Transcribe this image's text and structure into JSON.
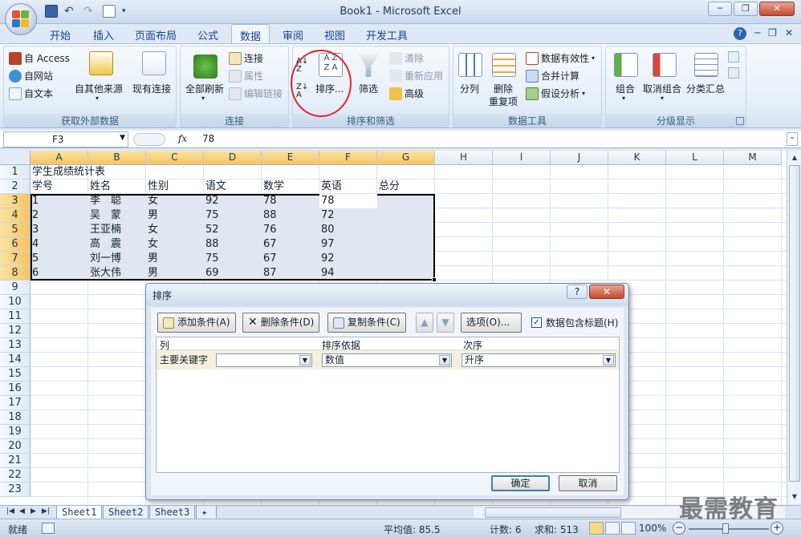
{
  "window": {
    "title": "Book1 - Microsoft Excel",
    "minimize_glyph": "─",
    "restore_glyph": "❐",
    "close_glyph": "✕"
  },
  "quick_access": [
    "save-icon",
    "undo-icon",
    "redo-icon",
    "print-preview-icon"
  ],
  "ribbon_tabs": [
    "开始",
    "插入",
    "页面布局",
    "公式",
    "数据",
    "审阅",
    "视图",
    "开发工具"
  ],
  "active_tab": "数据",
  "ribbon_right": {
    "help": "?",
    "min": "─",
    "restore": "❐",
    "close": "✕"
  },
  "ribbon": {
    "external": {
      "label": "获取外部数据",
      "access": "自 Access",
      "web": "自网站",
      "text": "自文本",
      "other": "自其他来源",
      "existing": "现有连接"
    },
    "connections": {
      "label": "连接",
      "refresh_all": "全部刷新",
      "connections": "连接",
      "properties": "属性",
      "edit_links": "编辑链接"
    },
    "sort_filter": {
      "label": "排序和筛选",
      "sort": "排序...",
      "filter": "筛选",
      "clear": "清除",
      "reapply": "重新应用",
      "advanced": "高级"
    },
    "data_tools": {
      "label": "数据工具",
      "text_to_columns": "分列",
      "remove_dup_1": "删除",
      "remove_dup_2": "重复项",
      "validation": "数据有效性",
      "consolidate": "合并计算",
      "what_if": "假设分析"
    },
    "outline": {
      "label": "分级显示",
      "group": "组合",
      "ungroup": "取消组合",
      "subtotal": "分类汇总"
    }
  },
  "formula_bar": {
    "name_box": "F3",
    "fx": "fx",
    "value": "78"
  },
  "columns": [
    "A",
    "B",
    "C",
    "D",
    "E",
    "F",
    "G",
    "H",
    "I",
    "J",
    "K",
    "L",
    "M"
  ],
  "rows": [
    "1",
    "2",
    "3",
    "4",
    "5",
    "6",
    "7",
    "8",
    "9",
    "10",
    "11",
    "12",
    "13",
    "14",
    "15",
    "16",
    "17",
    "18",
    "19",
    "20",
    "21",
    "22",
    "23"
  ],
  "cells": {
    "r1": {
      "a": "学生成绩统计表"
    },
    "header": [
      "学号",
      "姓名",
      "性别",
      "语文",
      "数学",
      "英语",
      "总分"
    ],
    "data": [
      [
        "1",
        "李　聪",
        "女",
        "92",
        "78",
        "78"
      ],
      [
        "2",
        "吴　蒙",
        "男",
        "75",
        "88",
        "72"
      ],
      [
        "3",
        "王亚楠",
        "女",
        "52",
        "76",
        "80"
      ],
      [
        "4",
        "高　震",
        "女",
        "88",
        "67",
        "97"
      ],
      [
        "5",
        "刘一博",
        "男",
        "75",
        "67",
        "92"
      ],
      [
        "6",
        "张大伟",
        "男",
        "69",
        "87",
        "94"
      ]
    ]
  },
  "sheets": [
    "Sheet1",
    "Sheet2",
    "Sheet3"
  ],
  "active_sheet": "Sheet1",
  "status": {
    "ready": "就绪",
    "average": "平均值: 85.5",
    "count": "计数: 6",
    "sum": "求和: 513",
    "zoom": "100%"
  },
  "dialog": {
    "title": "排序",
    "help": "?",
    "close": "✕",
    "add_level": "添加条件(A)",
    "delete_level": "删除条件(D)",
    "copy_level": "复制条件(C)",
    "options": "选项(O)...",
    "has_headers": "数据包含标题(H)",
    "has_headers_checked": "✓",
    "col_header": "列",
    "sort_on_header": "排序依据",
    "order_header": "次序",
    "row_label": "主要关键字",
    "column_value": "",
    "sort_on_value": "数值",
    "order_value": "升序",
    "ok": "确定",
    "cancel": "取消"
  },
  "watermark": "最需教育"
}
